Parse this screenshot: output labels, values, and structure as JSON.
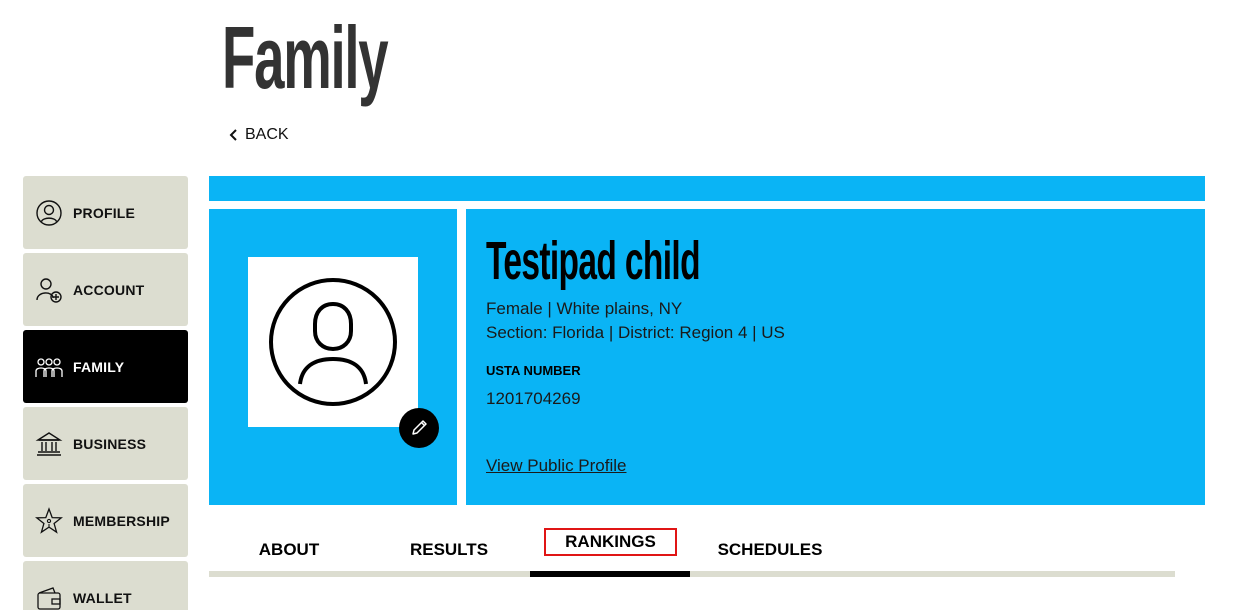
{
  "page": {
    "title": "Family",
    "back_label": "BACK"
  },
  "sidebar": {
    "items": [
      {
        "label": "PROFILE",
        "icon": "profile-icon",
        "active": false
      },
      {
        "label": "ACCOUNT",
        "icon": "account-add-icon",
        "active": false
      },
      {
        "label": "FAMILY",
        "icon": "family-icon",
        "active": true
      },
      {
        "label": "BUSINESS",
        "icon": "bank-icon",
        "active": false
      },
      {
        "label": "MEMBERSHIP",
        "icon": "star-icon",
        "active": false
      },
      {
        "label": "WALLET",
        "icon": "wallet-icon",
        "active": false
      }
    ]
  },
  "player": {
    "name": "Testipad child",
    "line1": "Female | White plains, NY",
    "line2": "Section: Florida | District: Region 4 | US",
    "usta_label": "USTA NUMBER",
    "usta_number": "1201704269",
    "public_profile_label": "View Public Profile",
    "avatar_icon": "user-avatar-icon",
    "edit_icon": "pencil-icon"
  },
  "tabs": [
    {
      "label": "ABOUT"
    },
    {
      "label": "RESULTS"
    },
    {
      "label": "RANKINGS",
      "selected": true
    },
    {
      "label": "SCHEDULES"
    }
  ],
  "colors": {
    "accent_blue": "#0ab4f5",
    "sidebar_bg": "#dcddd0",
    "active_bg": "#000000",
    "highlight_border": "#e01515"
  }
}
